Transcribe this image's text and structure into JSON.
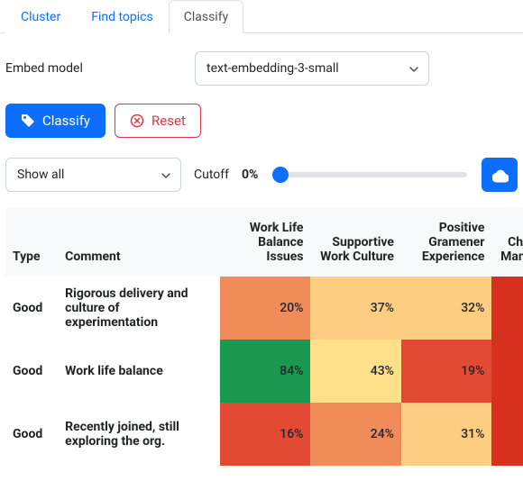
{
  "tabs": {
    "cluster": "Cluster",
    "find": "Find topics",
    "classify": "Classify"
  },
  "embed": {
    "label": "Embed model",
    "selected": "text-embedding-3-small"
  },
  "buttons": {
    "classify": "Classify",
    "reset": "Reset"
  },
  "show": {
    "selected": "Show all"
  },
  "cutoff": {
    "label": "Cutoff",
    "value": "0%"
  },
  "headers": {
    "type": "Type",
    "comment": "Comment",
    "c1": "Work Life Balance Issues",
    "c2": "Supportive Work Culture",
    "c3": "Positive Gramener Experience",
    "c4": "Challenging Management"
  },
  "chart_data": {
    "type": "heatmap",
    "columns": [
      "Work Life Balance Issues",
      "Supportive Work Culture",
      "Positive Gramener Experience",
      "Challenging Management"
    ],
    "rows": [
      {
        "type": "Good",
        "comment": "Rigorous delivery and culture of experimentation",
        "values": [
          20,
          37,
          32,
          null
        ]
      },
      {
        "type": "Good",
        "comment": "Work life balance",
        "values": [
          84,
          43,
          19,
          null
        ]
      },
      {
        "type": "Good",
        "comment": "Recently joined, still exploring the org.",
        "values": [
          16,
          24,
          31,
          null
        ]
      }
    ],
    "cutoff": 0,
    "value_format": "percent"
  },
  "colors": {
    "primary": "#0d6efd",
    "danger": "#dc3545",
    "scale": {
      "low": "#d73027",
      "midlow": "#ef8a62",
      "midhigh": "#fee08b",
      "high": "#1a9850"
    }
  }
}
